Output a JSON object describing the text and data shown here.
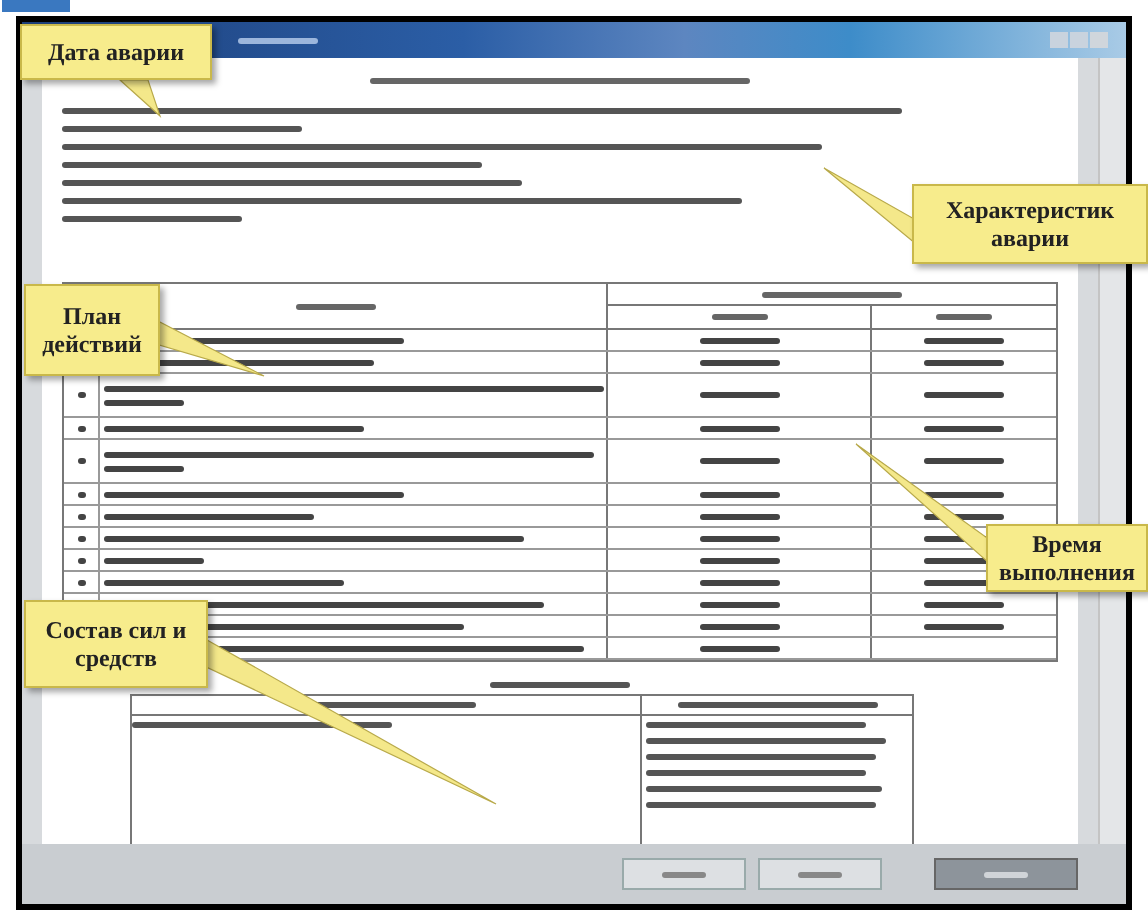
{
  "callouts": [
    {
      "text": "Дата аварии"
    },
    {
      "text": "Характеристик аварии"
    },
    {
      "text": "План действий"
    },
    {
      "text": "Время выполнения"
    },
    {
      "text": "Состав сил и средств"
    }
  ],
  "actions_table": {
    "rows": [
      {
        "kind": "single",
        "has_end": true
      },
      {
        "kind": "single",
        "has_end": true
      },
      {
        "kind": "double",
        "has_end": true
      },
      {
        "kind": "single",
        "has_end": true
      },
      {
        "kind": "double",
        "has_end": true
      },
      {
        "kind": "single",
        "has_end": true
      },
      {
        "kind": "single",
        "has_end": true
      },
      {
        "kind": "single",
        "has_end": true
      },
      {
        "kind": "single",
        "has_end": true
      },
      {
        "kind": "single",
        "has_end": true
      },
      {
        "kind": "single",
        "has_end": true
      },
      {
        "kind": "single",
        "has_end": true
      },
      {
        "kind": "single",
        "has_end": false
      }
    ]
  },
  "buttons": [
    {
      "kind": "normal"
    },
    {
      "kind": "normal"
    },
    {
      "kind": "primary"
    }
  ]
}
